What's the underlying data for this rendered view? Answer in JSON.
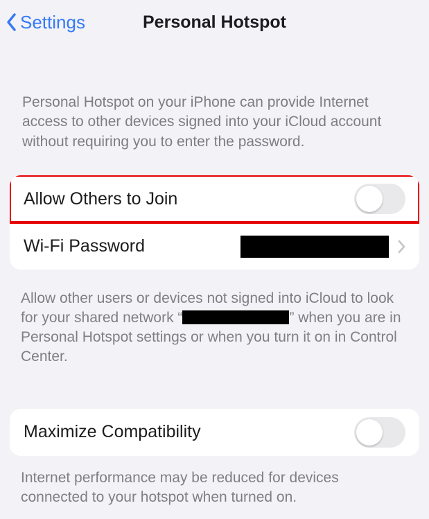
{
  "nav": {
    "back_label": "Settings",
    "title": "Personal Hotspot"
  },
  "intro": "Personal Hotspot on your iPhone can provide Internet access to other devices signed into your iCloud account without requiring you to enter the password.",
  "group1": {
    "allow_label": "Allow Others to Join",
    "allow_on": false,
    "wifi_label": "Wi-Fi Password"
  },
  "help1_a": "Allow other users or devices not signed into iCloud to look for your shared network “",
  "help1_b": "” when you are in Personal Hotspot settings or when you turn it on in Control Center.",
  "group2": {
    "max_label": "Maximize Compatibility",
    "max_on": false
  },
  "help2": "Internet performance may be reduced for devices connected to your hotspot when turned on."
}
